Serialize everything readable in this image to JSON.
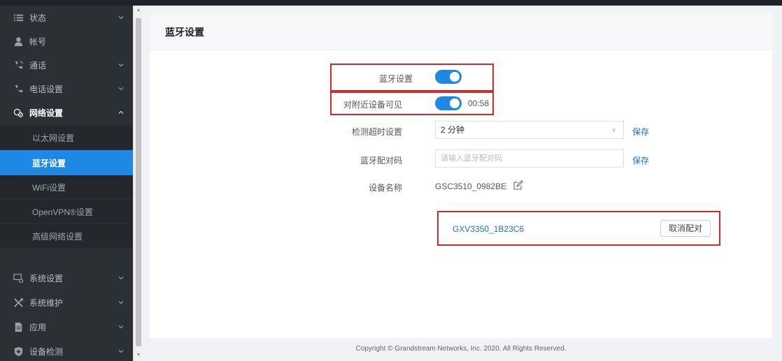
{
  "sidebar": {
    "items": [
      {
        "label": "状态",
        "icon": "list-icon",
        "chevron": true
      },
      {
        "label": "帐号",
        "icon": "user-icon",
        "chevron": false
      },
      {
        "label": "通话",
        "icon": "phone-call-icon",
        "chevron": true
      },
      {
        "label": "电话设置",
        "icon": "phone-icon",
        "chevron": true
      },
      {
        "label": "网络设置",
        "icon": "network-icon",
        "chevron": true,
        "expanded": true
      },
      {
        "label": "系统设置",
        "icon": "system-settings-icon",
        "chevron": true
      },
      {
        "label": "系统维护",
        "icon": "tools-icon",
        "chevron": true
      },
      {
        "label": "应用",
        "icon": "app-icon",
        "chevron": true
      },
      {
        "label": "设备检测",
        "icon": "shield-icon",
        "chevron": true
      }
    ],
    "network_sub": [
      {
        "label": "以太网设置"
      },
      {
        "label": "蓝牙设置",
        "active": true
      },
      {
        "label": "WiFi设置"
      },
      {
        "label": "OpenVPN®设置"
      },
      {
        "label": "高级网络设置"
      }
    ]
  },
  "header": {
    "title": "蓝牙设置"
  },
  "form": {
    "bluetooth_label": "蓝牙设置",
    "bluetooth_on": true,
    "visible_label": "对附近设备可见",
    "visible_on": true,
    "visible_timer": "00:58",
    "timeout_label": "检测超时设置",
    "timeout_value": "2 分钟",
    "timeout_save": "保存",
    "pin_label": "蓝牙配对码",
    "pin_placeholder": "请输入蓝牙配对码",
    "pin_save": "保存",
    "device_name_label": "设备名称",
    "device_name_value": "GSC3510_0982BE"
  },
  "paired": {
    "device": "GXV3350_1B23C6",
    "unpair_label": "取消配对"
  },
  "footer": {
    "text": "Copyright © Grandstream Networks, Inc. 2020. All Rights Reserved."
  },
  "colors": {
    "accent": "#1e88e5",
    "highlight": "#d9272e",
    "sidebar": "#2b3035"
  }
}
